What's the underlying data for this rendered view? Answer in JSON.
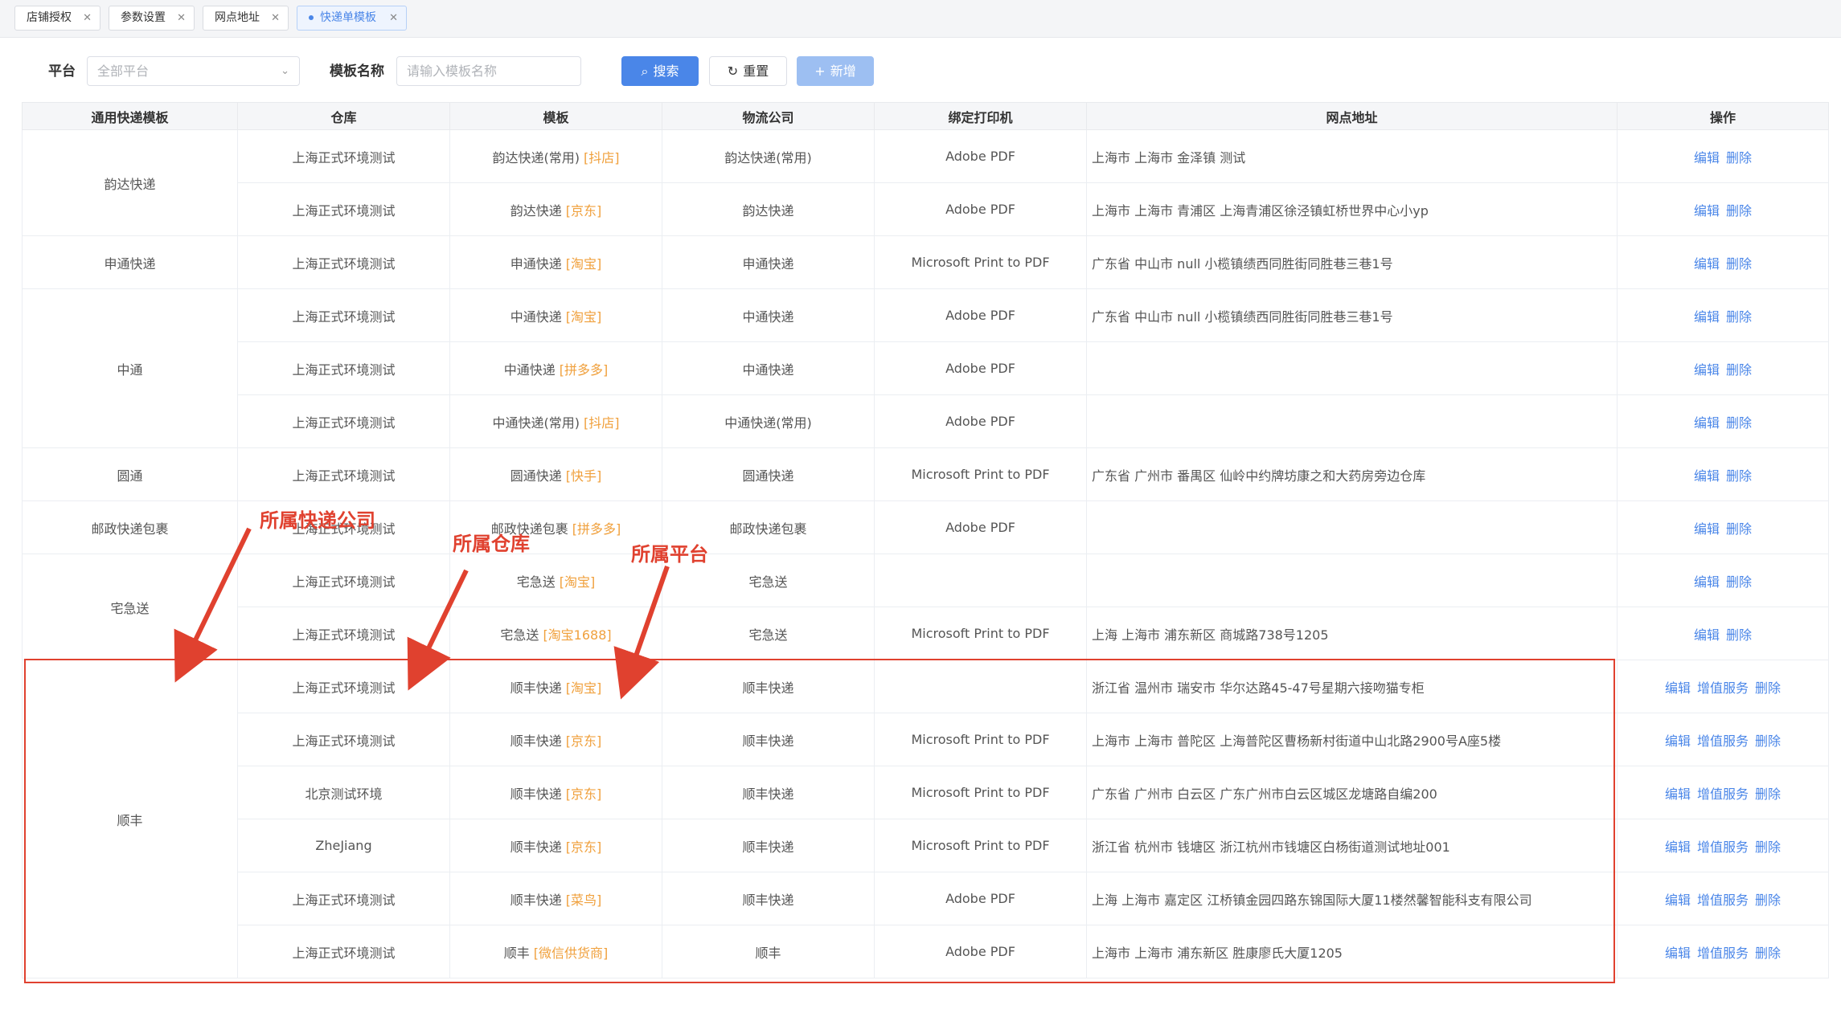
{
  "tabs": [
    {
      "label": "店铺授权",
      "active": false
    },
    {
      "label": "参数设置",
      "active": false
    },
    {
      "label": "网点地址",
      "active": false
    },
    {
      "label": "快递单模板",
      "active": true
    }
  ],
  "filters": {
    "platform_label": "平台",
    "platform_placeholder": "全部平台",
    "template_name_label": "模板名称",
    "template_name_placeholder": "请输入模板名称",
    "search_button": "搜索",
    "reset_button": "重置",
    "add_button": "新增"
  },
  "table": {
    "columns": [
      "通用快递模板",
      "仓库",
      "模板",
      "物流公司",
      "绑定打印机",
      "网点地址",
      "操作"
    ],
    "op_labels": {
      "edit": "编辑",
      "value_added": "增值服务",
      "delete": "删除"
    },
    "rows": [
      {
        "group": "韵达快递",
        "warehouse": "上海正式环境测试",
        "template": "韵达快递(常用)",
        "platform": "[抖店]",
        "company": "韵达快递(常用)",
        "printer": "Adobe PDF",
        "address": "上海市 上海市 金泽镇 测试",
        "value_added": false
      },
      {
        "group": "韵达快递",
        "warehouse": "上海正式环境测试",
        "template": "韵达快递",
        "platform": "[京东]",
        "company": "韵达快递",
        "printer": "Adobe PDF",
        "address": "上海市 上海市 青浦区 上海青浦区徐泾镇虹桥世界中心小yp",
        "value_added": false
      },
      {
        "group": "申通快递",
        "warehouse": "上海正式环境测试",
        "template": "申通快递",
        "platform": "[淘宝]",
        "company": "申通快递",
        "printer": "Microsoft Print to PDF",
        "address": "广东省 中山市 null 小榄镇绩西同胜街同胜巷三巷1号",
        "value_added": false
      },
      {
        "group": "中通",
        "warehouse": "上海正式环境测试",
        "template": "中通快递",
        "platform": "[淘宝]",
        "company": "中通快递",
        "printer": "Adobe PDF",
        "address": "广东省 中山市 null 小榄镇绩西同胜街同胜巷三巷1号",
        "value_added": false
      },
      {
        "group": "中通",
        "warehouse": "上海正式环境测试",
        "template": "中通快递",
        "platform": "[拼多多]",
        "company": "中通快递",
        "printer": "Adobe PDF",
        "address": "",
        "value_added": false
      },
      {
        "group": "中通",
        "warehouse": "上海正式环境测试",
        "template": "中通快递(常用)",
        "platform": "[抖店]",
        "company": "中通快递(常用)",
        "printer": "Adobe PDF",
        "address": "",
        "value_added": false
      },
      {
        "group": "圆通",
        "warehouse": "上海正式环境测试",
        "template": "圆通快递",
        "platform": "[快手]",
        "company": "圆通快递",
        "printer": "Microsoft Print to PDF",
        "address": "广东省 广州市 番禺区 仙岭中约牌坊康之和大药房旁边仓库",
        "value_added": false
      },
      {
        "group": "邮政快递包裹",
        "warehouse": "上海正式环境测试",
        "template": "邮政快递包裹",
        "platform": "[拼多多]",
        "company": "邮政快递包裹",
        "printer": "Adobe PDF",
        "address": "",
        "value_added": false
      },
      {
        "group": "宅急送",
        "warehouse": "上海正式环境测试",
        "template": "宅急送",
        "platform": "[淘宝]",
        "company": "宅急送",
        "printer": "",
        "address": "",
        "value_added": false
      },
      {
        "group": "宅急送",
        "warehouse": "上海正式环境测试",
        "template": "宅急送",
        "platform": "[淘宝1688]",
        "company": "宅急送",
        "printer": "Microsoft Print to PDF",
        "address": "上海 上海市 浦东新区 商城路738号1205",
        "value_added": false
      },
      {
        "group": "顺丰",
        "warehouse": "上海正式环境测试",
        "template": "顺丰快递",
        "platform": "[淘宝]",
        "company": "顺丰快递",
        "printer": "",
        "address": "浙江省 温州市 瑞安市 华尔达路45-47号星期六接吻猫专柜",
        "value_added": true
      },
      {
        "group": "顺丰",
        "warehouse": "上海正式环境测试",
        "template": "顺丰快递",
        "platform": "[京东]",
        "company": "顺丰快递",
        "printer": "Microsoft Print to PDF",
        "address": "上海市 上海市 普陀区 上海普陀区曹杨新村街道中山北路2900号A座5楼",
        "value_added": true
      },
      {
        "group": "顺丰",
        "warehouse": "北京测试环境",
        "template": "顺丰快递",
        "platform": "[京东]",
        "company": "顺丰快递",
        "printer": "Microsoft Print to PDF",
        "address": "广东省 广州市 白云区 广东广州市白云区城区龙塘路自编200",
        "value_added": true
      },
      {
        "group": "顺丰",
        "warehouse": "ZheJiang",
        "template": "顺丰快递",
        "platform": "[京东]",
        "company": "顺丰快递",
        "printer": "Microsoft Print to PDF",
        "address": "浙江省 杭州市 钱塘区 浙江杭州市钱塘区白杨街道测试地址001",
        "value_added": true
      },
      {
        "group": "顺丰",
        "warehouse": "上海正式环境测试",
        "template": "顺丰快递",
        "platform": "[菜鸟]",
        "company": "顺丰快递",
        "printer": "Adobe PDF",
        "address": "上海 上海市 嘉定区 江桥镇金园四路东锦国际大厦11楼然馨智能科支有限公司",
        "value_added": true
      },
      {
        "group": "顺丰",
        "warehouse": "上海正式环境测试",
        "template": "顺丰",
        "platform": "[微信供货商]",
        "company": "顺丰",
        "printer": "Adobe PDF",
        "address": "上海市 上海市 浦东新区 胜康廖氏大厦1205",
        "value_added": true
      }
    ]
  },
  "annotations": {
    "labels": [
      "所属快递公司",
      "所属仓库",
      "所属平台"
    ],
    "color": "#e0412f"
  },
  "colors": {
    "primary": "#4a86e8",
    "platform_tag": "#f0a03c",
    "annotation": "#e0412f"
  }
}
